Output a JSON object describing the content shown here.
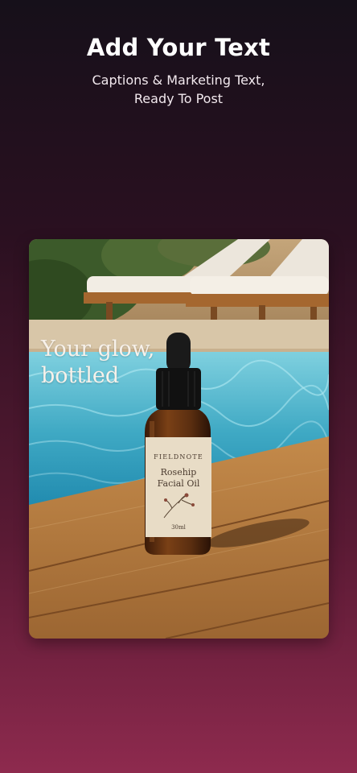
{
  "header": {
    "title": "Add Your Text",
    "subtitle_lines": [
      "Captions & Marketing Text,",
      "Ready To Post"
    ]
  },
  "preview": {
    "caption_lines": [
      "Your glow,",
      "bottled"
    ],
    "product_label": {
      "brand": "FIELDNOTE",
      "name_lines": [
        "Rosehip",
        "Facial Oil"
      ],
      "volume": "30ml"
    }
  },
  "colors": {
    "background_top": "#16101a",
    "background_bottom": "#8e2a4e",
    "headline": "#ffffff",
    "pool_water": "#3fa9c4",
    "deck_wood": "#b57a3f",
    "bottle_glass": "#5a2e10",
    "label_paper": "#e8dcc6"
  }
}
